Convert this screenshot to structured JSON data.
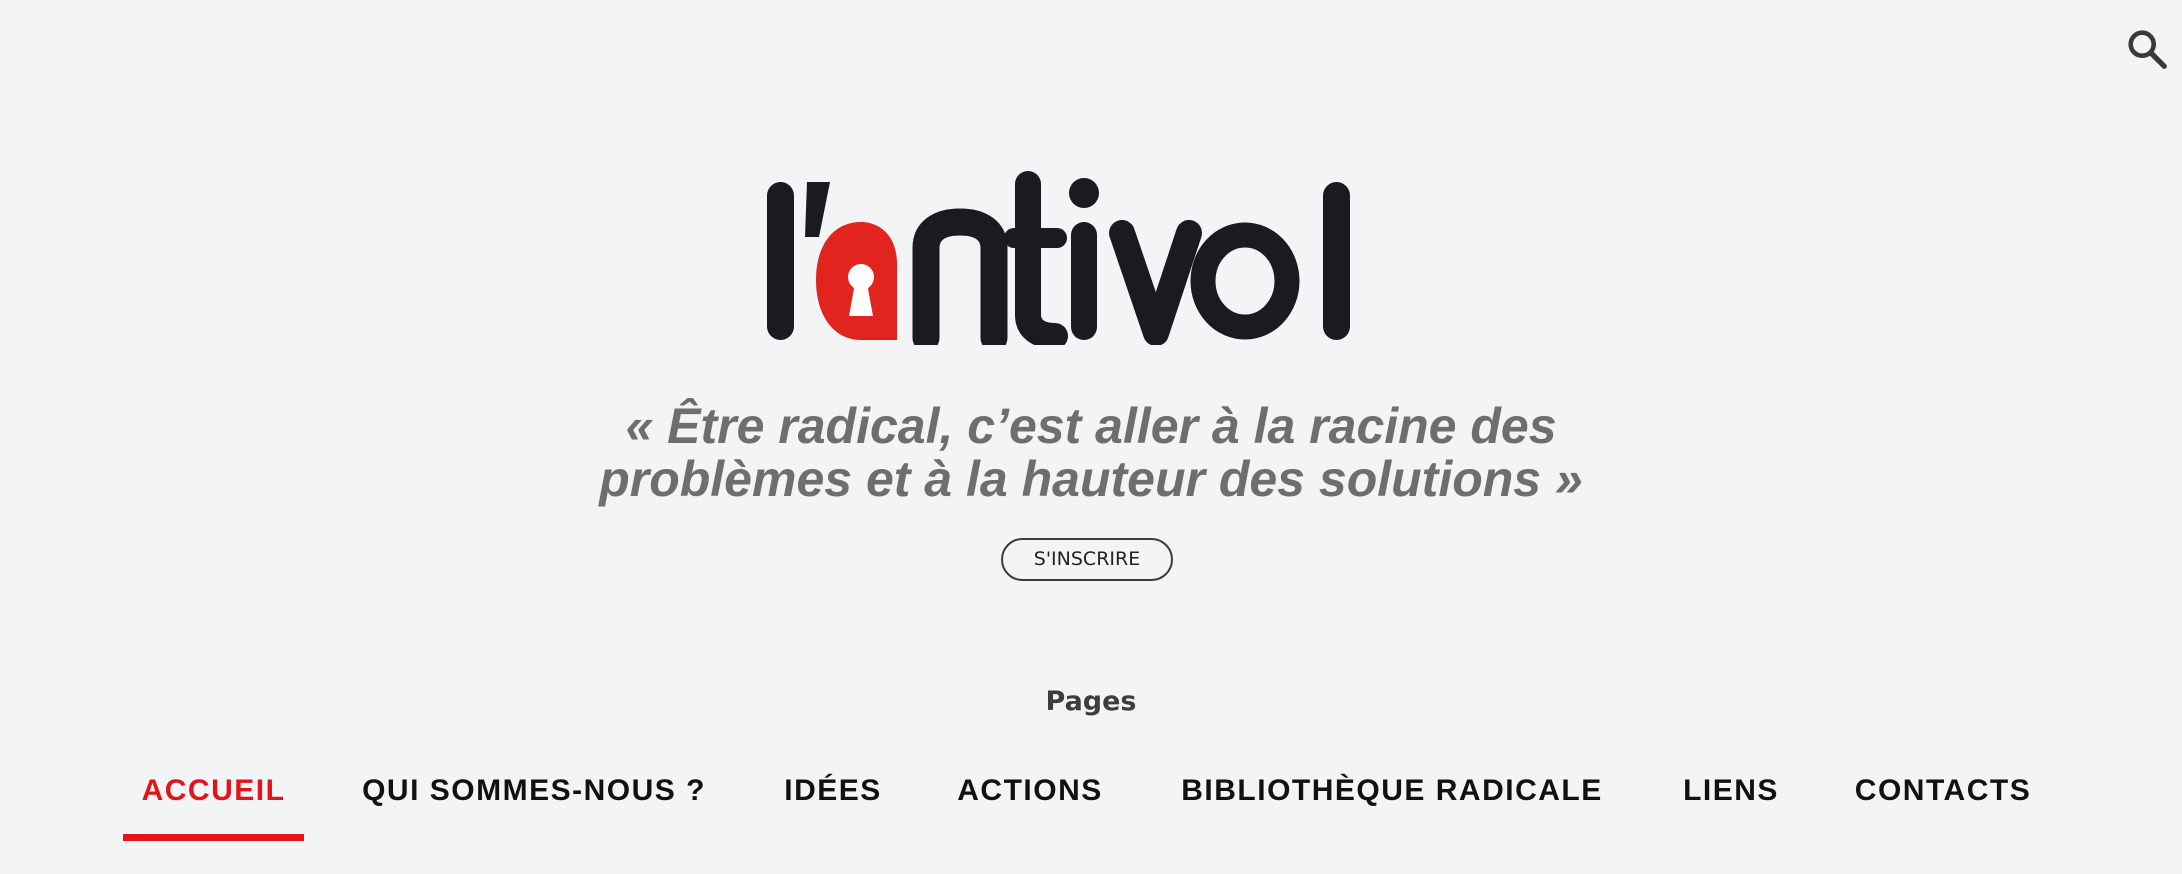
{
  "header": {
    "search_icon": "search-icon",
    "logo_text": "l'antivol",
    "brand_red": "#e2241f",
    "brand_dark": "#1a1a1f"
  },
  "tagline": {
    "line1": "« Être radical, c’est aller à la racine des",
    "line2": "problèmes et à la hauteur des solutions »"
  },
  "subscribe": {
    "label": "S'INSCRIRE"
  },
  "pages": {
    "heading": "Pages",
    "items": [
      {
        "label": "ACCUEIL",
        "active": true
      },
      {
        "label": "QUI SOMMES-NOUS ?",
        "active": false
      },
      {
        "label": "IDÉES",
        "active": false
      },
      {
        "label": "ACTIONS",
        "active": false
      },
      {
        "label": "BIBLIOTHÈQUE RADICALE",
        "active": false
      },
      {
        "label": "LIENS",
        "active": false
      },
      {
        "label": "CONTACTS",
        "active": false
      }
    ],
    "active_color": "#e2141a"
  }
}
